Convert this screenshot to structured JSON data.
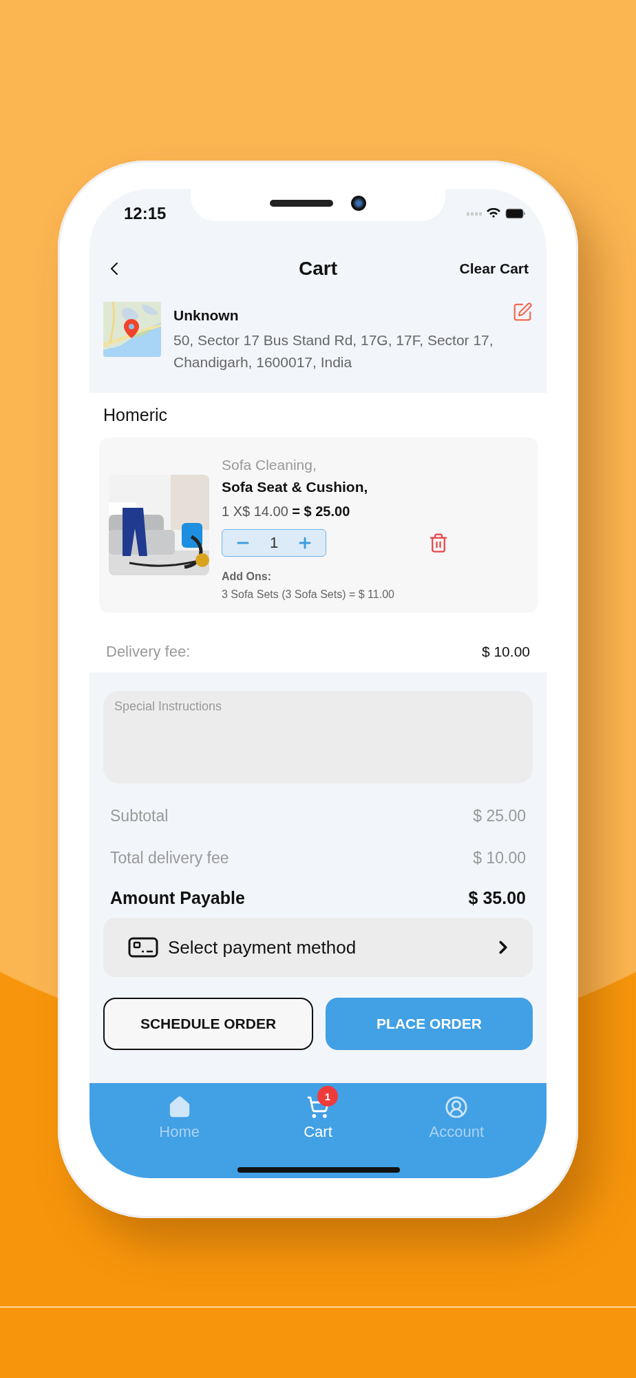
{
  "status_bar": {
    "time": "12:15"
  },
  "header": {
    "title": "Cart",
    "action": "Clear Cart"
  },
  "address": {
    "name": "Unknown",
    "line": "50, Sector 17 Bus Stand Rd, 17G, 17F, Sector 17, Chandigarh, 1600017, India"
  },
  "store": {
    "name": "Homeric"
  },
  "items": [
    {
      "category": "Sofa Cleaning,",
      "name": "Sofa Seat & Cushion,",
      "price": "1 X$ 14.00 **= $ 25.00**",
      "quantity": "1",
      "addons_label": "Add Ons:",
      "addons": "3 Sofa Sets (3 Sofa Sets) = $ 11.00"
    }
  ],
  "delivery": {
    "label": "Delivery fee:",
    "value": "$ 10.00"
  },
  "instructions": {
    "placeholder": "Special Instructions"
  },
  "summary": [
    {
      "label": "Subtotal",
      "value": "$ 25.00",
      "kind": "muted"
    },
    {
      "label": "Total delivery fee",
      "value": "$ 10.00",
      "kind": "muted"
    },
    {
      "label": "Amount Payable",
      "value": "$ 35.00",
      "kind": "total"
    }
  ],
  "payment": {
    "label": "Select payment method"
  },
  "buttons": [
    {
      "label": "SCHEDULE ORDER",
      "kind": "outline"
    },
    {
      "label": "PLACE ORDER",
      "kind": "primary"
    }
  ],
  "tabs": [
    {
      "label": "Home",
      "selected": false
    },
    {
      "label": "Cart",
      "selected": true,
      "badge": "1"
    },
    {
      "label": "Account",
      "selected": false
    }
  ]
}
